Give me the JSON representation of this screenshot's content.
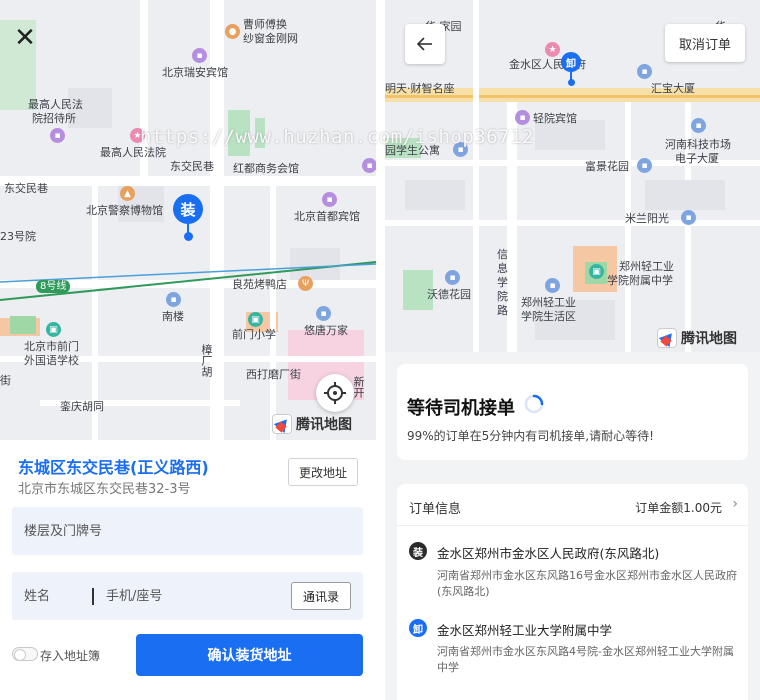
{
  "left_panel": {
    "map_labels": {
      "caoshi": "曹师傅换",
      "caoshi2": "纱窗金刚网",
      "ruian": "北京瑞安宾馆",
      "court_hotel_1": "最高人民法",
      "court_hotel_2": "院招待所",
      "court": "最高人民法院",
      "dongjiao_1": "东交民巷",
      "dongjiao_2": "东交民巷",
      "hongdu": "红都商务会馆",
      "police_museum": "北京警察博物馆",
      "capital_hotel": "北京首都宾馆",
      "no23": "23号院",
      "line8": "8号线",
      "liangyuan": "良苑烤鸭店",
      "nanlou": "南楼",
      "qianmen_school": "前门小学",
      "youtang": "悠唐万家",
      "foreign_school_1": "北京市前门",
      "foreign_school_2": "外国语学校",
      "zhangzhang": "樟厂胡",
      "xidamo": "西打磨厂街",
      "xinkai": "新开",
      "luanqing": "銮庆胡同",
      "jie": "街"
    },
    "pin_glyph": "装",
    "tencent_logo": "腾讯地图",
    "address_title": "东城区东交民巷(正义路西)",
    "address_sub": "北京市东城区东交民巷32-3号",
    "change_address": "更改地址",
    "floor_placeholder": "楼层及门牌号",
    "name_placeholder": "姓名",
    "phone_placeholder": "手机/座号",
    "contacts_button": "通讯录",
    "save_label": "存入地址簿",
    "confirm_button": "确认装货地址"
  },
  "right_panel": {
    "map_labels": {
      "top_garden": "华  家园",
      "jinshui": "金水区人民政府",
      "caifu": "明天·财智名座",
      "huibao": "汇宝大厦",
      "qingyuan": "轻院宾馆",
      "student_apt": "园学生公寓",
      "henan_tech_1": "河南科技市场",
      "henan_tech_2": "电子大厦",
      "fujing": "富景花园",
      "milan": "米兰阳光",
      "xinxi_1": "信",
      "xinxi_2": "息",
      "xinxi_3": "学",
      "xinxi_4": "院",
      "xinxi_5": "路",
      "zzu_school_1": "郑州轻工业",
      "zzu_school_2": "学院附属中学",
      "wode": "沃德花园",
      "zzu_life_1": "郑州轻工业",
      "zzu_life_2": "学院生活区",
      "top_right": "华"
    },
    "pin_glyph": "卸",
    "tencent_logo": "腾讯地图",
    "cancel_order": "取消订单",
    "status_title": "等待司机接单",
    "status_note": "99%的订单在5分钟内有司机接单,请耐心等待!",
    "order_label": "订单信息",
    "order_amount": "订单金额1.00元",
    "stops": [
      {
        "glyph": "装",
        "name": "金水区郑州市金水区人民政府(东风路北)",
        "detail": "河南省郑州市金水区东风路16号金水区郑州市金水区人民政府(东风路北)"
      },
      {
        "glyph": "卸",
        "name": "金水区郑州轻工业大学附属中学",
        "detail": "河南省郑州市金水区东风路4号院-金水区郑州轻工业大学附属中学"
      }
    ]
  },
  "watermark": "https://www.huzhan.com/ishop36712",
  "colors": {
    "accent": "#1a6ef2",
    "field_bg": "#eef2fb",
    "panel_bg": "#f2f3f5"
  }
}
